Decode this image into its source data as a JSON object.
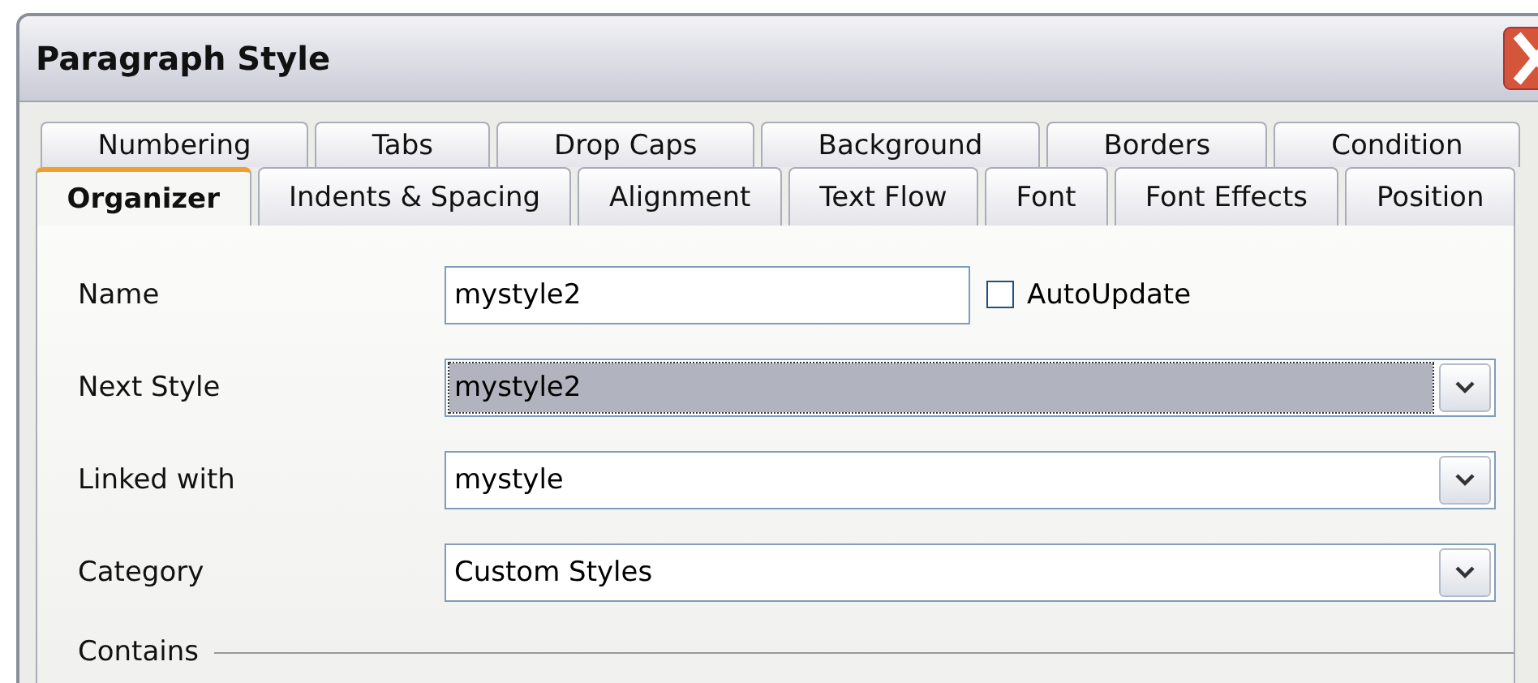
{
  "window": {
    "title": "Paragraph Style"
  },
  "tab_rows": [
    [
      {
        "label": "Numbering",
        "selected": false
      },
      {
        "label": "Tabs",
        "selected": false
      },
      {
        "label": "Drop Caps",
        "selected": false
      },
      {
        "label": "Background",
        "selected": false
      },
      {
        "label": "Borders",
        "selected": false
      },
      {
        "label": "Condition",
        "selected": false
      }
    ],
    [
      {
        "label": "Organizer",
        "selected": true
      },
      {
        "label": "Indents & Spacing",
        "selected": false
      },
      {
        "label": "Alignment",
        "selected": false
      },
      {
        "label": "Text Flow",
        "selected": false
      },
      {
        "label": "Font",
        "selected": false
      },
      {
        "label": "Font Effects",
        "selected": false
      },
      {
        "label": "Position",
        "selected": false
      }
    ]
  ],
  "fields": [
    {
      "kind": "text",
      "label": "Name",
      "value": "mystyle2",
      "highlighted": false,
      "checkbox": {
        "label": "AutoUpdate",
        "checked": false
      }
    },
    {
      "kind": "combo",
      "label": "Next Style",
      "value": "mystyle2",
      "highlighted": true
    },
    {
      "kind": "combo",
      "label": "Linked with",
      "value": "mystyle",
      "highlighted": false
    },
    {
      "kind": "combo",
      "label": "Category",
      "value": "Custom Styles",
      "highlighted": false
    }
  ],
  "contains": {
    "label": "Contains"
  }
}
